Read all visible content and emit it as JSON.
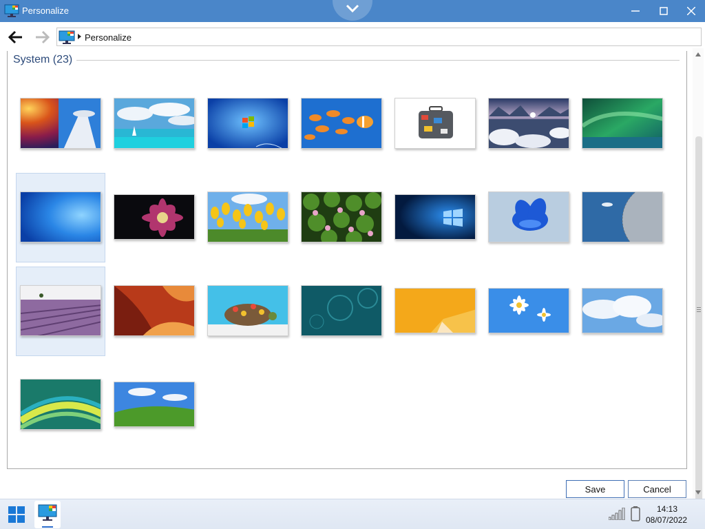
{
  "window": {
    "title": "Personalize"
  },
  "address": {
    "path": "Personalize"
  },
  "group": {
    "title": "System (23)"
  },
  "wallpapers": [
    {
      "icon": "space-needle-wallpaper"
    },
    {
      "icon": "tropical-sea-wallpaper"
    },
    {
      "icon": "windows-7-logo-wallpaper"
    },
    {
      "icon": "goldfish-wallpaper"
    },
    {
      "icon": "suitcase-wallpaper"
    },
    {
      "icon": "icebergs-wallpaper"
    },
    {
      "icon": "aurora-green-wallpaper"
    },
    {
      "icon": "blue-light-wallpaper"
    },
    {
      "icon": "purple-dahlia-wallpaper"
    },
    {
      "icon": "tulips-wallpaper"
    },
    {
      "icon": "water-lilies-wallpaper"
    },
    {
      "icon": "windows-10-logo-wallpaper"
    },
    {
      "icon": "windows-11-bloom-wallpaper"
    },
    {
      "icon": "metal-sphere-wallpaper"
    },
    {
      "icon": "lavender-field-wallpaper"
    },
    {
      "icon": "red-canyon-wallpaper"
    },
    {
      "icon": "turtle-art-wallpaper"
    },
    {
      "icon": "teal-bubbles-wallpaper"
    },
    {
      "icon": "orange-abstract-wallpaper"
    },
    {
      "icon": "daisies-wallpaper"
    },
    {
      "icon": "clouds-wallpaper"
    },
    {
      "icon": "vista-aurora-wallpaper"
    },
    {
      "icon": "bliss-hill-wallpaper"
    }
  ],
  "buttons": {
    "save": "Save",
    "cancel": "Cancel"
  },
  "taskbar": {
    "time": "14:13",
    "date": "08/07/2022"
  },
  "colors": {
    "titlebar": "#4a86c9",
    "accent": "#2a6ccd",
    "selection": "#e5eef9"
  }
}
